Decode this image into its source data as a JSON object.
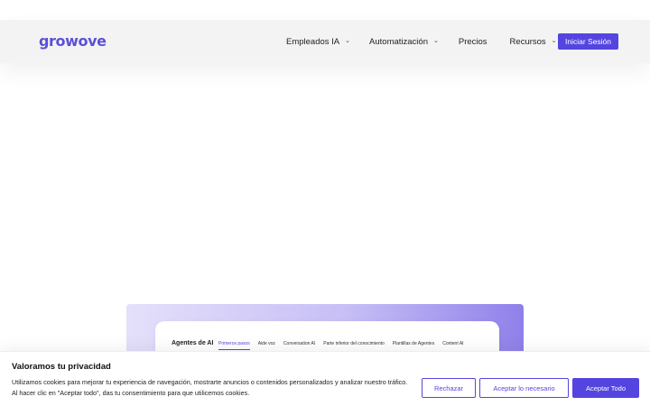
{
  "header": {
    "logo": "growove",
    "nav": [
      {
        "label": "Empleados IA",
        "has_dropdown": true
      },
      {
        "label": "Automatización",
        "has_dropdown": true
      },
      {
        "label": "Precios",
        "has_dropdown": false
      },
      {
        "label": "Recursos",
        "has_dropdown": true
      }
    ],
    "login_label": "Iniciar Sesión"
  },
  "preview": {
    "title": "Agentes de AI",
    "tabs": [
      {
        "label": "Primeros pasos",
        "active": true
      },
      {
        "label": "Aide voz"
      },
      {
        "label": "Conversation AI"
      },
      {
        "label": "Parte inferior del conocimiento"
      },
      {
        "label": "Plantillas de Agentes"
      },
      {
        "label": "Content AI"
      }
    ]
  },
  "cookie_banner": {
    "title": "Valoramos tu privacidad",
    "text": "Utilizamos cookies para mejorar tu experiencia de navegación, mostrarte anuncios o contenidos personalizados y analizar nuestro tráfico. Al hacer clic en \"Aceptar todo\", das tu consentimiento para que utilicemos cookies.",
    "reject_label": "Rechazar",
    "necessary_label": "Aceptar lo necesario",
    "accept_all_label": "Aceptar Todo"
  },
  "colors": {
    "accent": "#5545e0",
    "logo": "#5b50d6",
    "header_bg": "#f3f3f4"
  }
}
